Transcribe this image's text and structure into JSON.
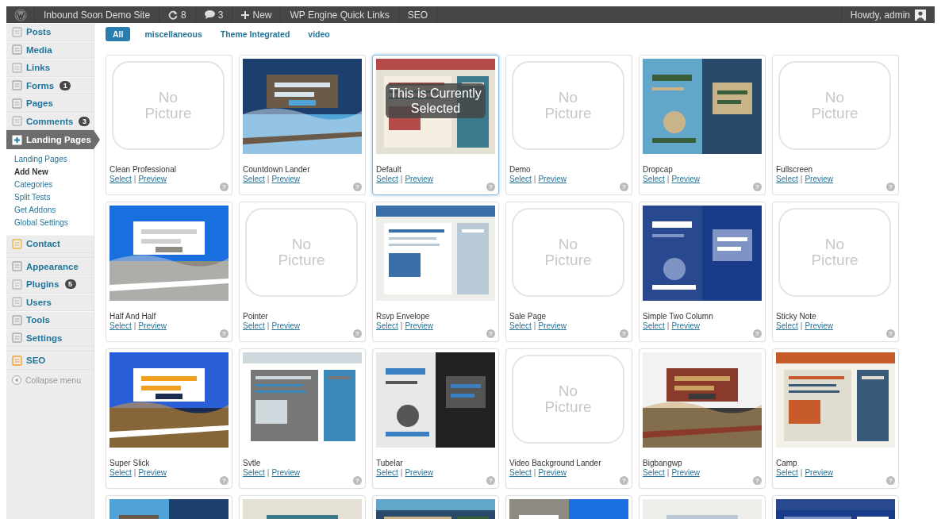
{
  "admin_bar": {
    "site_name": "Inbound Soon Demo Site",
    "updates": "8",
    "comments": "3",
    "new": "New",
    "items": [
      "WP Engine Quick Links",
      "SEO"
    ],
    "greeting": "Howdy, admin"
  },
  "sidebar": {
    "items": [
      {
        "label": "Posts",
        "kind": "item",
        "selected": false
      },
      {
        "label": "Media",
        "kind": "item",
        "selected": false
      },
      {
        "label": "Links",
        "kind": "item",
        "selected": false
      },
      {
        "label": "Forms",
        "kind": "item",
        "selected": false,
        "badge": "1"
      },
      {
        "label": "Pages",
        "kind": "item",
        "selected": false
      },
      {
        "label": "Comments",
        "kind": "item",
        "selected": false,
        "badge": "3"
      },
      {
        "label": "Landing Pages",
        "kind": "item",
        "selected": true,
        "children": [
          {
            "label": "Landing Pages",
            "selected": false
          },
          {
            "label": "Add New",
            "selected": true
          },
          {
            "label": "Categories",
            "selected": false
          },
          {
            "label": "Split Tests",
            "selected": false
          },
          {
            "label": "Get Addons",
            "selected": false
          },
          {
            "label": "Global Settings",
            "selected": false
          }
        ]
      },
      {
        "label": "Contact",
        "kind": "item",
        "selected": false
      },
      {
        "kind": "separator"
      },
      {
        "label": "Appearance",
        "kind": "item",
        "selected": false
      },
      {
        "label": "Plugins",
        "kind": "item",
        "selected": false,
        "badge": "5"
      },
      {
        "label": "Users",
        "kind": "item",
        "selected": false
      },
      {
        "label": "Tools",
        "kind": "item",
        "selected": false
      },
      {
        "label": "Settings",
        "kind": "item",
        "selected": false
      },
      {
        "kind": "separator"
      },
      {
        "label": "SEO",
        "kind": "item",
        "selected": false
      },
      {
        "label": "Collapse menu",
        "kind": "collapse"
      }
    ]
  },
  "filters": [
    {
      "label": "All",
      "selected": true
    },
    {
      "label": "miscellaneous",
      "selected": false
    },
    {
      "label": "Theme Integrated",
      "selected": false
    },
    {
      "label": "video",
      "selected": false
    }
  ],
  "templates": [
    {
      "name": "Clean Professional",
      "thumbnail": {
        "kind": "placeholder",
        "text": "No Picture"
      },
      "selected": false,
      "actions": [
        "Select",
        "|",
        "Preview"
      ],
      "help": "?"
    },
    {
      "name": "Countdown Lander",
      "thumbnail": {
        "kind": "picture"
      },
      "selected": false,
      "actions": [
        "Select",
        "|",
        "Preview"
      ],
      "help": "?"
    },
    {
      "name": "Default",
      "thumbnail": {
        "kind": "picture"
      },
      "selected": true,
      "overlay": "This is Currently Selected",
      "actions": [
        "Select",
        "|",
        "Preview"
      ],
      "help": "?"
    },
    {
      "name": "Demo",
      "thumbnail": {
        "kind": "placeholder",
        "text": "No Picture"
      },
      "selected": false,
      "actions": [
        "Select",
        "|",
        "Preview"
      ],
      "help": "?"
    },
    {
      "name": "Dropcap",
      "thumbnail": {
        "kind": "picture"
      },
      "selected": false,
      "actions": [
        "Select",
        "|",
        "Preview"
      ],
      "help": "?"
    },
    {
      "name": "Fullscreen",
      "thumbnail": {
        "kind": "placeholder",
        "text": "No Picture"
      },
      "selected": false,
      "actions": [
        "Select",
        "|",
        "Preview"
      ],
      "help": "?"
    },
    {
      "name": "Half And Half",
      "thumbnail": {
        "kind": "picture"
      },
      "selected": false,
      "actions": [
        "Select",
        "|",
        "Preview"
      ],
      "help": "?"
    },
    {
      "name": "Pointer",
      "thumbnail": {
        "kind": "placeholder",
        "text": "No Picture"
      },
      "selected": false,
      "actions": [
        "Select",
        "|",
        "Preview"
      ],
      "help": "?"
    },
    {
      "name": "Rsvp Envelope",
      "thumbnail": {
        "kind": "picture"
      },
      "selected": false,
      "actions": [
        "Select",
        "|",
        "Preview"
      ],
      "help": "?"
    },
    {
      "name": "Sale Page",
      "thumbnail": {
        "kind": "placeholder",
        "text": "No Picture"
      },
      "selected": false,
      "actions": [
        "Select",
        "|",
        "Preview"
      ],
      "help": "?"
    },
    {
      "name": "Simple Two Column",
      "thumbnail": {
        "kind": "picture"
      },
      "selected": false,
      "actions": [
        "Select",
        "|",
        "Preview"
      ],
      "help": "?"
    },
    {
      "name": "Sticky Note",
      "thumbnail": {
        "kind": "placeholder",
        "text": "No Picture"
      },
      "selected": false,
      "actions": [
        "Select",
        "|",
        "Preview"
      ],
      "help": "?"
    },
    {
      "name": "Super Slick",
      "thumbnail": {
        "kind": "picture"
      },
      "selected": false,
      "actions": [
        "Select",
        "|",
        "Preview"
      ],
      "help": "?"
    },
    {
      "name": "Svtle",
      "thumbnail": {
        "kind": "picture"
      },
      "selected": false,
      "actions": [
        "Select",
        "|",
        "Preview"
      ],
      "help": "?"
    },
    {
      "name": "Tubelar",
      "thumbnail": {
        "kind": "picture"
      },
      "selected": false,
      "actions": [
        "Select",
        "|",
        "Preview"
      ],
      "help": "?"
    },
    {
      "name": "Video Background Lander",
      "thumbnail": {
        "kind": "placeholder",
        "text": "No Picture"
      },
      "selected": false,
      "actions": [
        "Select",
        "|",
        "Preview"
      ],
      "help": "?"
    },
    {
      "name": "Bigbangwp",
      "thumbnail": {
        "kind": "picture"
      },
      "selected": false,
      "actions": [
        "Select",
        "|",
        "Preview"
      ],
      "help": "?"
    },
    {
      "name": "Camp",
      "thumbnail": {
        "kind": "picture"
      },
      "selected": false,
      "actions": [
        "Select",
        "|",
        "Preview"
      ],
      "help": "?"
    },
    {
      "thumbnail": {
        "kind": "picture"
      },
      "selected": false
    },
    {
      "thumbnail": {
        "kind": "picture"
      },
      "selected": false
    },
    {
      "thumbnail": {
        "kind": "picture"
      },
      "selected": false
    },
    {
      "thumbnail": {
        "kind": "picture"
      },
      "selected": false
    },
    {
      "thumbnail": {
        "kind": "picture"
      },
      "selected": false
    },
    {
      "thumbnail": {
        "kind": "picture"
      },
      "selected": false
    }
  ]
}
